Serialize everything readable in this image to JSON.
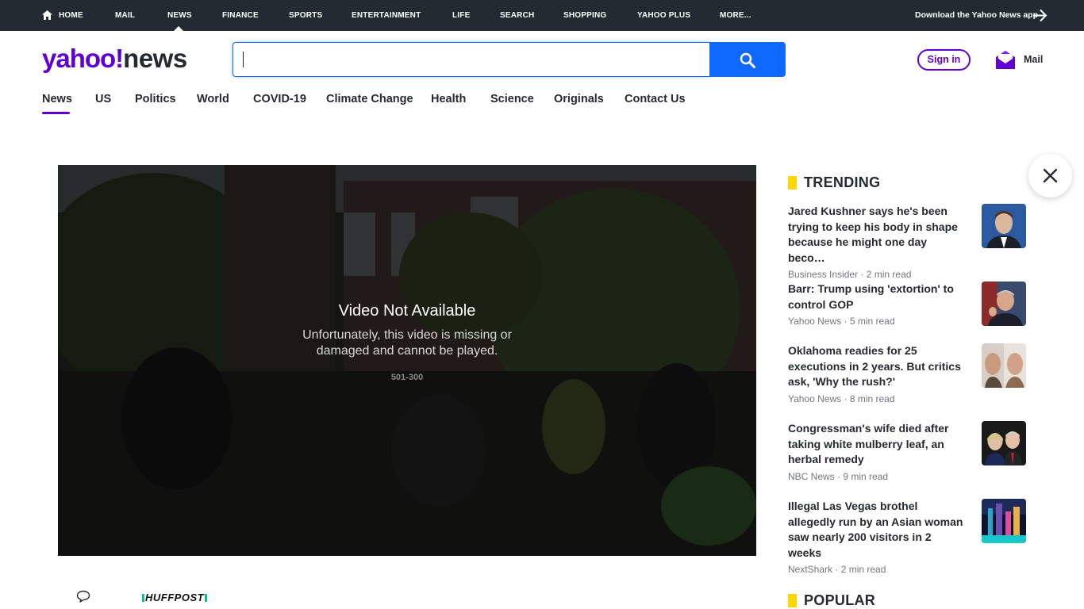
{
  "topnav": {
    "items": [
      {
        "label": "HOME"
      },
      {
        "label": "MAIL"
      },
      {
        "label": "NEWS"
      },
      {
        "label": "FINANCE"
      },
      {
        "label": "SPORTS"
      },
      {
        "label": "ENTERTAINMENT"
      },
      {
        "label": "LIFE"
      },
      {
        "label": "SEARCH"
      },
      {
        "label": "SHOPPING"
      },
      {
        "label": "YAHOO PLUS"
      },
      {
        "label": "MORE..."
      }
    ],
    "active": "NEWS",
    "download_label": "Download the Yahoo News app"
  },
  "header": {
    "logo_yahoo": "yahoo!",
    "logo_news": "news",
    "search_value": "",
    "signin_label": "Sign in",
    "mail_label": "Mail"
  },
  "sections": {
    "tabs": [
      {
        "label": "News"
      },
      {
        "label": "US"
      },
      {
        "label": "Politics"
      },
      {
        "label": "World"
      },
      {
        "label": "COVID-19"
      },
      {
        "label": "Climate Change"
      },
      {
        "label": "Health"
      },
      {
        "label": "Science"
      },
      {
        "label": "Originals"
      },
      {
        "label": "Contact Us"
      }
    ],
    "active": "News"
  },
  "video": {
    "title": "Video Not Available",
    "body": "Unfortunately, this video is missing or damaged and cannot be played.",
    "code": "501-300"
  },
  "article": {
    "source_logo": "HUFFPOST"
  },
  "trending": {
    "title": "TRENDING",
    "items": [
      {
        "headline": "Jared Kushner says he's been trying to keep his body in shape because he might one day beco…",
        "source": "Business Insider",
        "read": "2 min read"
      },
      {
        "headline": "Barr: Trump using 'extortion' to control GOP",
        "source": "Yahoo News",
        "read": "5 min read"
      },
      {
        "headline": "Oklahoma readies for 25 executions in 2 years. But critics ask, 'Why the rush?'",
        "source": "Yahoo News",
        "read": "8 min read"
      },
      {
        "headline": "Congressman's wife died after taking white mulberry leaf, an herbal remedy",
        "source": "NBC News",
        "read": "9 min read"
      },
      {
        "headline": "Illegal Las Vegas brothel allegedly run by an Asian woman saw nearly 200 visitors in 2 weeks",
        "source": "NextShark",
        "read": "2 min read"
      }
    ]
  },
  "popular": {
    "title": "POPULAR"
  },
  "colors": {
    "topbar": "#232a31",
    "brand_purple": "#6001d2",
    "search_blue": "#0f69ff",
    "section_marker": "#ffd600"
  }
}
